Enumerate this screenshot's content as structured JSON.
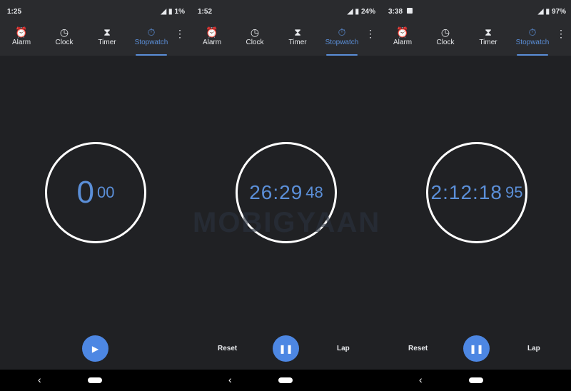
{
  "tabs": [
    {
      "label": "Alarm",
      "icon": "alarm-icon"
    },
    {
      "label": "Clock",
      "icon": "clock-icon"
    },
    {
      "label": "Timer",
      "icon": "hourglass-icon"
    },
    {
      "label": "Stopwatch",
      "icon": "stopwatch-icon"
    }
  ],
  "accent": "#5b8fd8",
  "watermark": "MOBIGYAAN",
  "panels": [
    {
      "status_time": "1:25",
      "battery": "1%",
      "main": "0",
      "hundredths": "00",
      "fab": "play",
      "reset": "",
      "lap": ""
    },
    {
      "status_time": "1:52",
      "battery": "24%",
      "main": "26:29",
      "hundredths": "48",
      "fab": "pause",
      "reset": "Reset",
      "lap": "Lap"
    },
    {
      "status_time": "3:38",
      "battery": "97%",
      "main": "2:12:18",
      "hundredths": "95",
      "fab": "pause",
      "reset": "Reset",
      "lap": "Lap"
    }
  ]
}
